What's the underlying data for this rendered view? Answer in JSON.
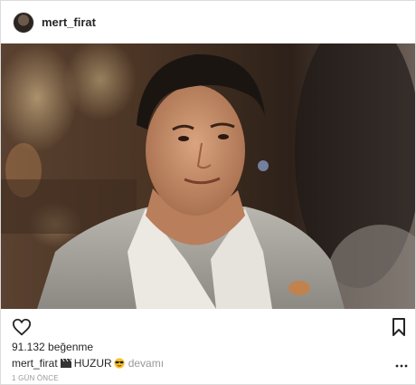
{
  "post": {
    "username": "mert_firat",
    "avatar_icon": "profile-avatar",
    "photo_description_icon": "portrait-photo",
    "likes_text": "91.132 beğenme",
    "caption_user": "mert_firat",
    "caption_text": "HUZUR",
    "caption_more": "devamı",
    "time_text": "1 GÜN ÖNCE",
    "icons": {
      "like": "heart-icon",
      "save": "bookmark-icon",
      "options": "more-options-icon",
      "clapper": "clapperboard-icon",
      "sunglasses": "sunglasses-emoji-icon"
    }
  }
}
